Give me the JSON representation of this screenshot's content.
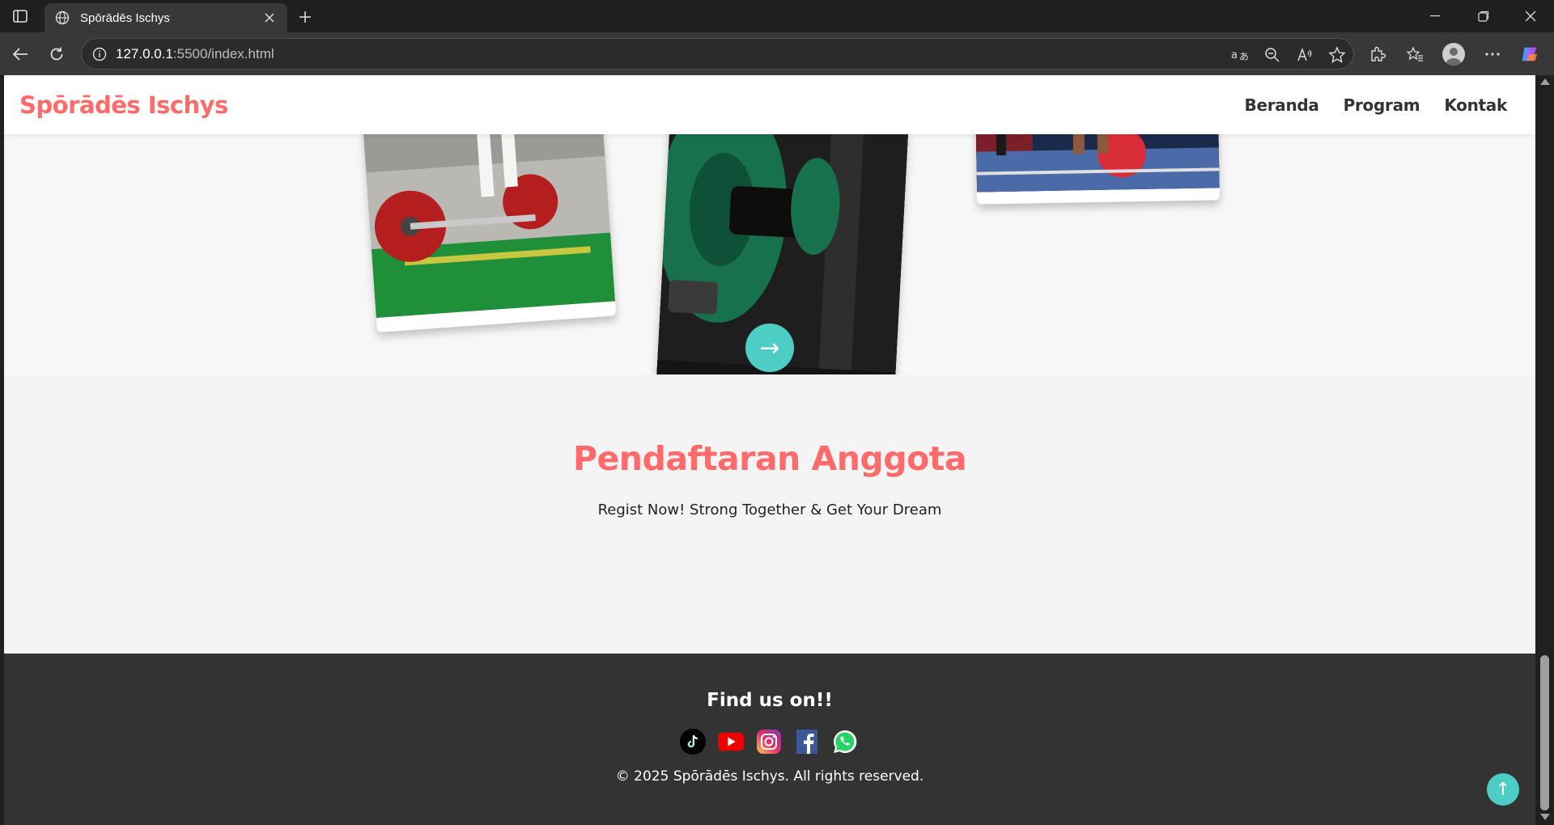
{
  "browser": {
    "tab_title": "Spōrādēs Ischys",
    "url_host": "127.0.0.1",
    "url_path": ":5500/index.html"
  },
  "site": {
    "logo": "Spōrādēs Ischys",
    "nav": [
      "Beranda",
      "Program",
      "Kontak"
    ],
    "accent_color": "#ff6b6b",
    "secondary_color": "#4ecdc4"
  },
  "register": {
    "title": "Pendaftaran Anggota",
    "subtitle": "Regist Now! Strong Together & Get Your Dream",
    "button_icon": "→"
  },
  "footer": {
    "heading": "Find us on!!",
    "socials": [
      "tiktok-icon",
      "youtube-icon",
      "instagram-icon",
      "facebook-icon",
      "whatsapp-icon"
    ],
    "copyright": "© 2025 Spōrādēs Ischys. All rights reserved.",
    "back_to_top_icon": "↑"
  }
}
